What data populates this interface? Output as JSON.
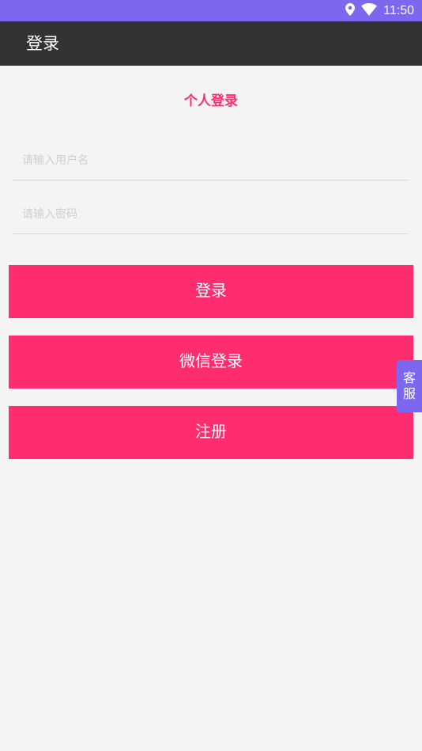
{
  "status_bar": {
    "time": "11:50",
    "icons": [
      "location-icon",
      "wifi-icon"
    ]
  },
  "app_bar": {
    "title": "登录"
  },
  "login": {
    "section_title": "个人登录",
    "username_placeholder": "请输入用户名",
    "password_placeholder": "请输入密码",
    "login_label": "登录",
    "wechat_label": "微信登录",
    "register_label": "注册"
  },
  "side_service": {
    "char1": "客",
    "char2": "服"
  },
  "colors": {
    "accent": "#ff2d6f",
    "status_bar": "#7b68ee",
    "app_bar": "#333333",
    "background": "#f4f4f4"
  }
}
